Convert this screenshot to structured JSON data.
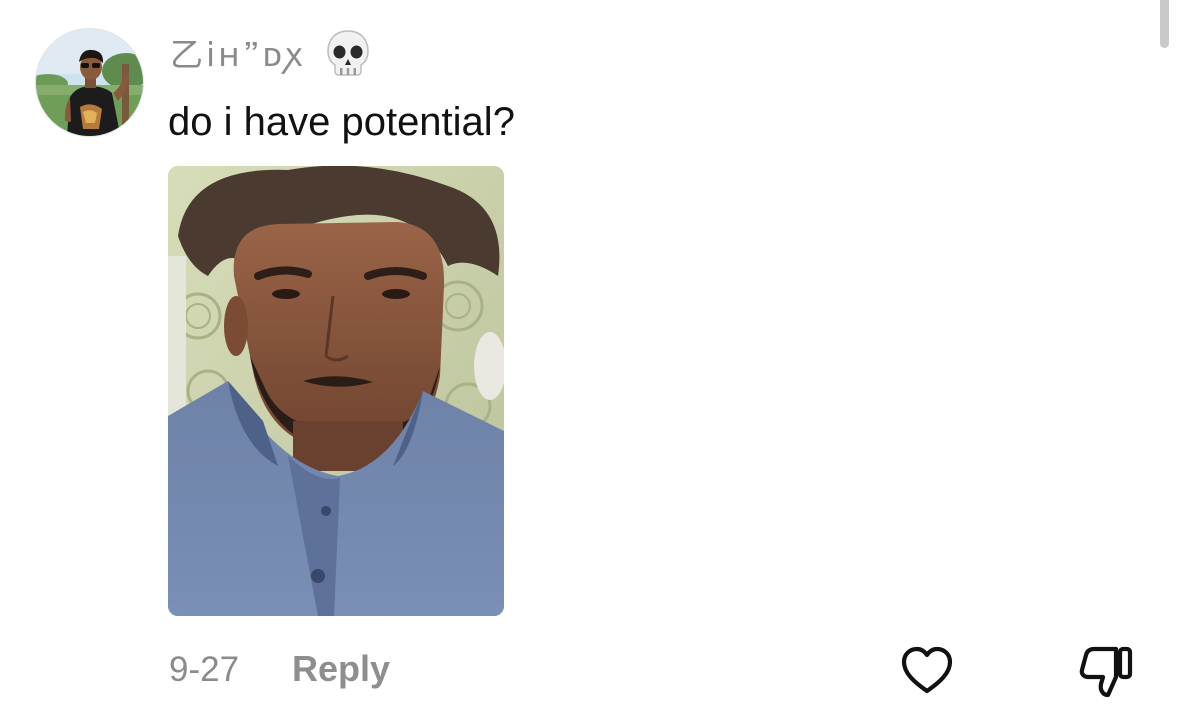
{
  "comment": {
    "username": "乙iн🙷ᴅꭗ",
    "username_emoji": "skull-icon",
    "text": "do i have potential?",
    "date": "9-27",
    "reply_label": "Reply"
  },
  "actions": {
    "like_icon": "heart-outline-icon",
    "dislike_icon": "thumbs-down-outline-icon"
  },
  "colors": {
    "text_primary": "#111111",
    "text_secondary": "#8b8b8b",
    "background": "#ffffff"
  }
}
